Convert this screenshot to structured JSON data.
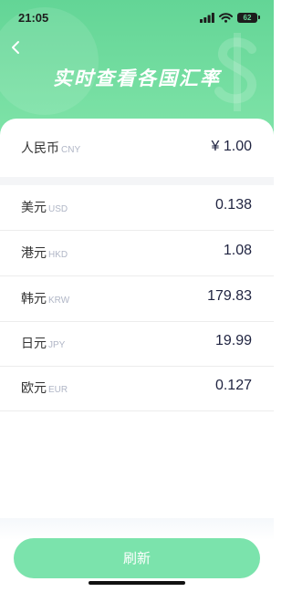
{
  "status": {
    "time": "21:05",
    "battery": "62"
  },
  "header": {
    "title": "实时查看各国汇率",
    "back_icon": "chevron-left-icon"
  },
  "base_currency": {
    "name": "人民币",
    "code": "CNY",
    "value": "¥ 1.00"
  },
  "rates": [
    {
      "name": "美元",
      "code": "USD",
      "value": "0.138"
    },
    {
      "name": "港元",
      "code": "HKD",
      "value": "1.08"
    },
    {
      "name": "韩元",
      "code": "KRW",
      "value": "179.83"
    },
    {
      "name": "日元",
      "code": "JPY",
      "value": "19.99"
    },
    {
      "name": "欧元",
      "code": "EUR",
      "value": "0.127"
    }
  ],
  "refresh_label": "刷新",
  "colors": {
    "accent": "#63d596",
    "button": "#7be3ac"
  }
}
